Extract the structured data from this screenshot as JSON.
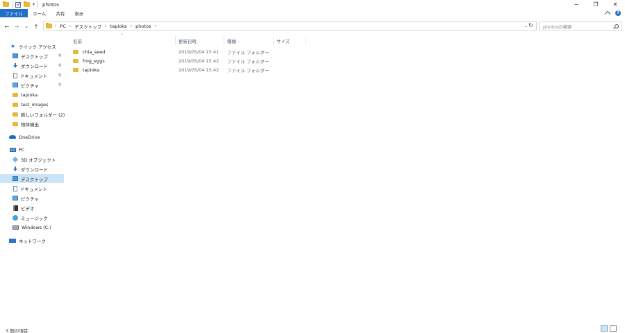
{
  "window": {
    "title": "photos",
    "qa_dropdown": "▾",
    "controls": {
      "minimize": "─",
      "maximize": "❐",
      "close": "✕"
    }
  },
  "ribbon": {
    "tabs": [
      {
        "label": "ファイル",
        "active": true
      },
      {
        "label": "ホーム",
        "active": false
      },
      {
        "label": "共有",
        "active": false
      },
      {
        "label": "表示",
        "active": false
      }
    ],
    "help": "?"
  },
  "nav": {
    "back": "←",
    "forward": "→",
    "recent": "⌄",
    "up": "↑",
    "breadcrumbs": [
      "PC",
      "デスクトップ",
      "tapioka",
      "photos"
    ],
    "refresh": "↻"
  },
  "search": {
    "placeholder": "photosの検索"
  },
  "sidebar": {
    "items": [
      {
        "label": "クイック アクセス",
        "icon": "star-icon",
        "pinned": false
      },
      {
        "label": "デスクトップ",
        "icon": "desktop-icon",
        "pinned": true
      },
      {
        "label": "ダウンロード",
        "icon": "download-icon",
        "pinned": true
      },
      {
        "label": "ドキュメント",
        "icon": "document-icon",
        "pinned": true
      },
      {
        "label": "ピクチャ",
        "icon": "picture-icon",
        "pinned": true
      },
      {
        "label": "tapioka",
        "icon": "folder-icon"
      },
      {
        "label": "test_images",
        "icon": "folder-icon"
      },
      {
        "label": "新しいフォルダー (2)",
        "icon": "folder-icon"
      },
      {
        "label": "物体検出",
        "icon": "folder-icon"
      },
      {
        "label": "OneDrive",
        "icon": "cloud-icon"
      },
      {
        "label": "PC",
        "icon": "pc-icon"
      },
      {
        "label": "3D オブジェクト",
        "icon": "3d-objects-icon"
      },
      {
        "label": "ダウンロード",
        "icon": "download-icon"
      },
      {
        "label": "デスクトップ",
        "icon": "desktop-icon",
        "selected": true
      },
      {
        "label": "ドキュメント",
        "icon": "document-icon"
      },
      {
        "label": "ピクチャ",
        "icon": "picture-icon"
      },
      {
        "label": "ビデオ",
        "icon": "video-icon"
      },
      {
        "label": "ミュージック",
        "icon": "music-icon"
      },
      {
        "label": "Windows (C:)",
        "icon": "drive-icon"
      },
      {
        "label": "ネットワーク",
        "icon": "network-icon"
      }
    ],
    "pin_glyph": "📌"
  },
  "list": {
    "sort_caret": "⌃",
    "columns": [
      "名前",
      "更新日時",
      "種類",
      "サイズ"
    ],
    "rows": [
      {
        "name": "chia_seed",
        "modified": "2019/05/04 15:41",
        "type": "ファイル フォルダー",
        "size": ""
      },
      {
        "name": "frog_eggs",
        "modified": "2019/05/04 15:42",
        "type": "ファイル フォルダー",
        "size": ""
      },
      {
        "name": "tapioka",
        "modified": "2019/05/04 15:42",
        "type": "ファイル フォルダー",
        "size": ""
      }
    ]
  },
  "status": {
    "item_count": "3 個の項目"
  },
  "colors": {
    "accent": "#1d6fc9",
    "selection": "#cce4f7",
    "folder": "#e8b83a"
  }
}
